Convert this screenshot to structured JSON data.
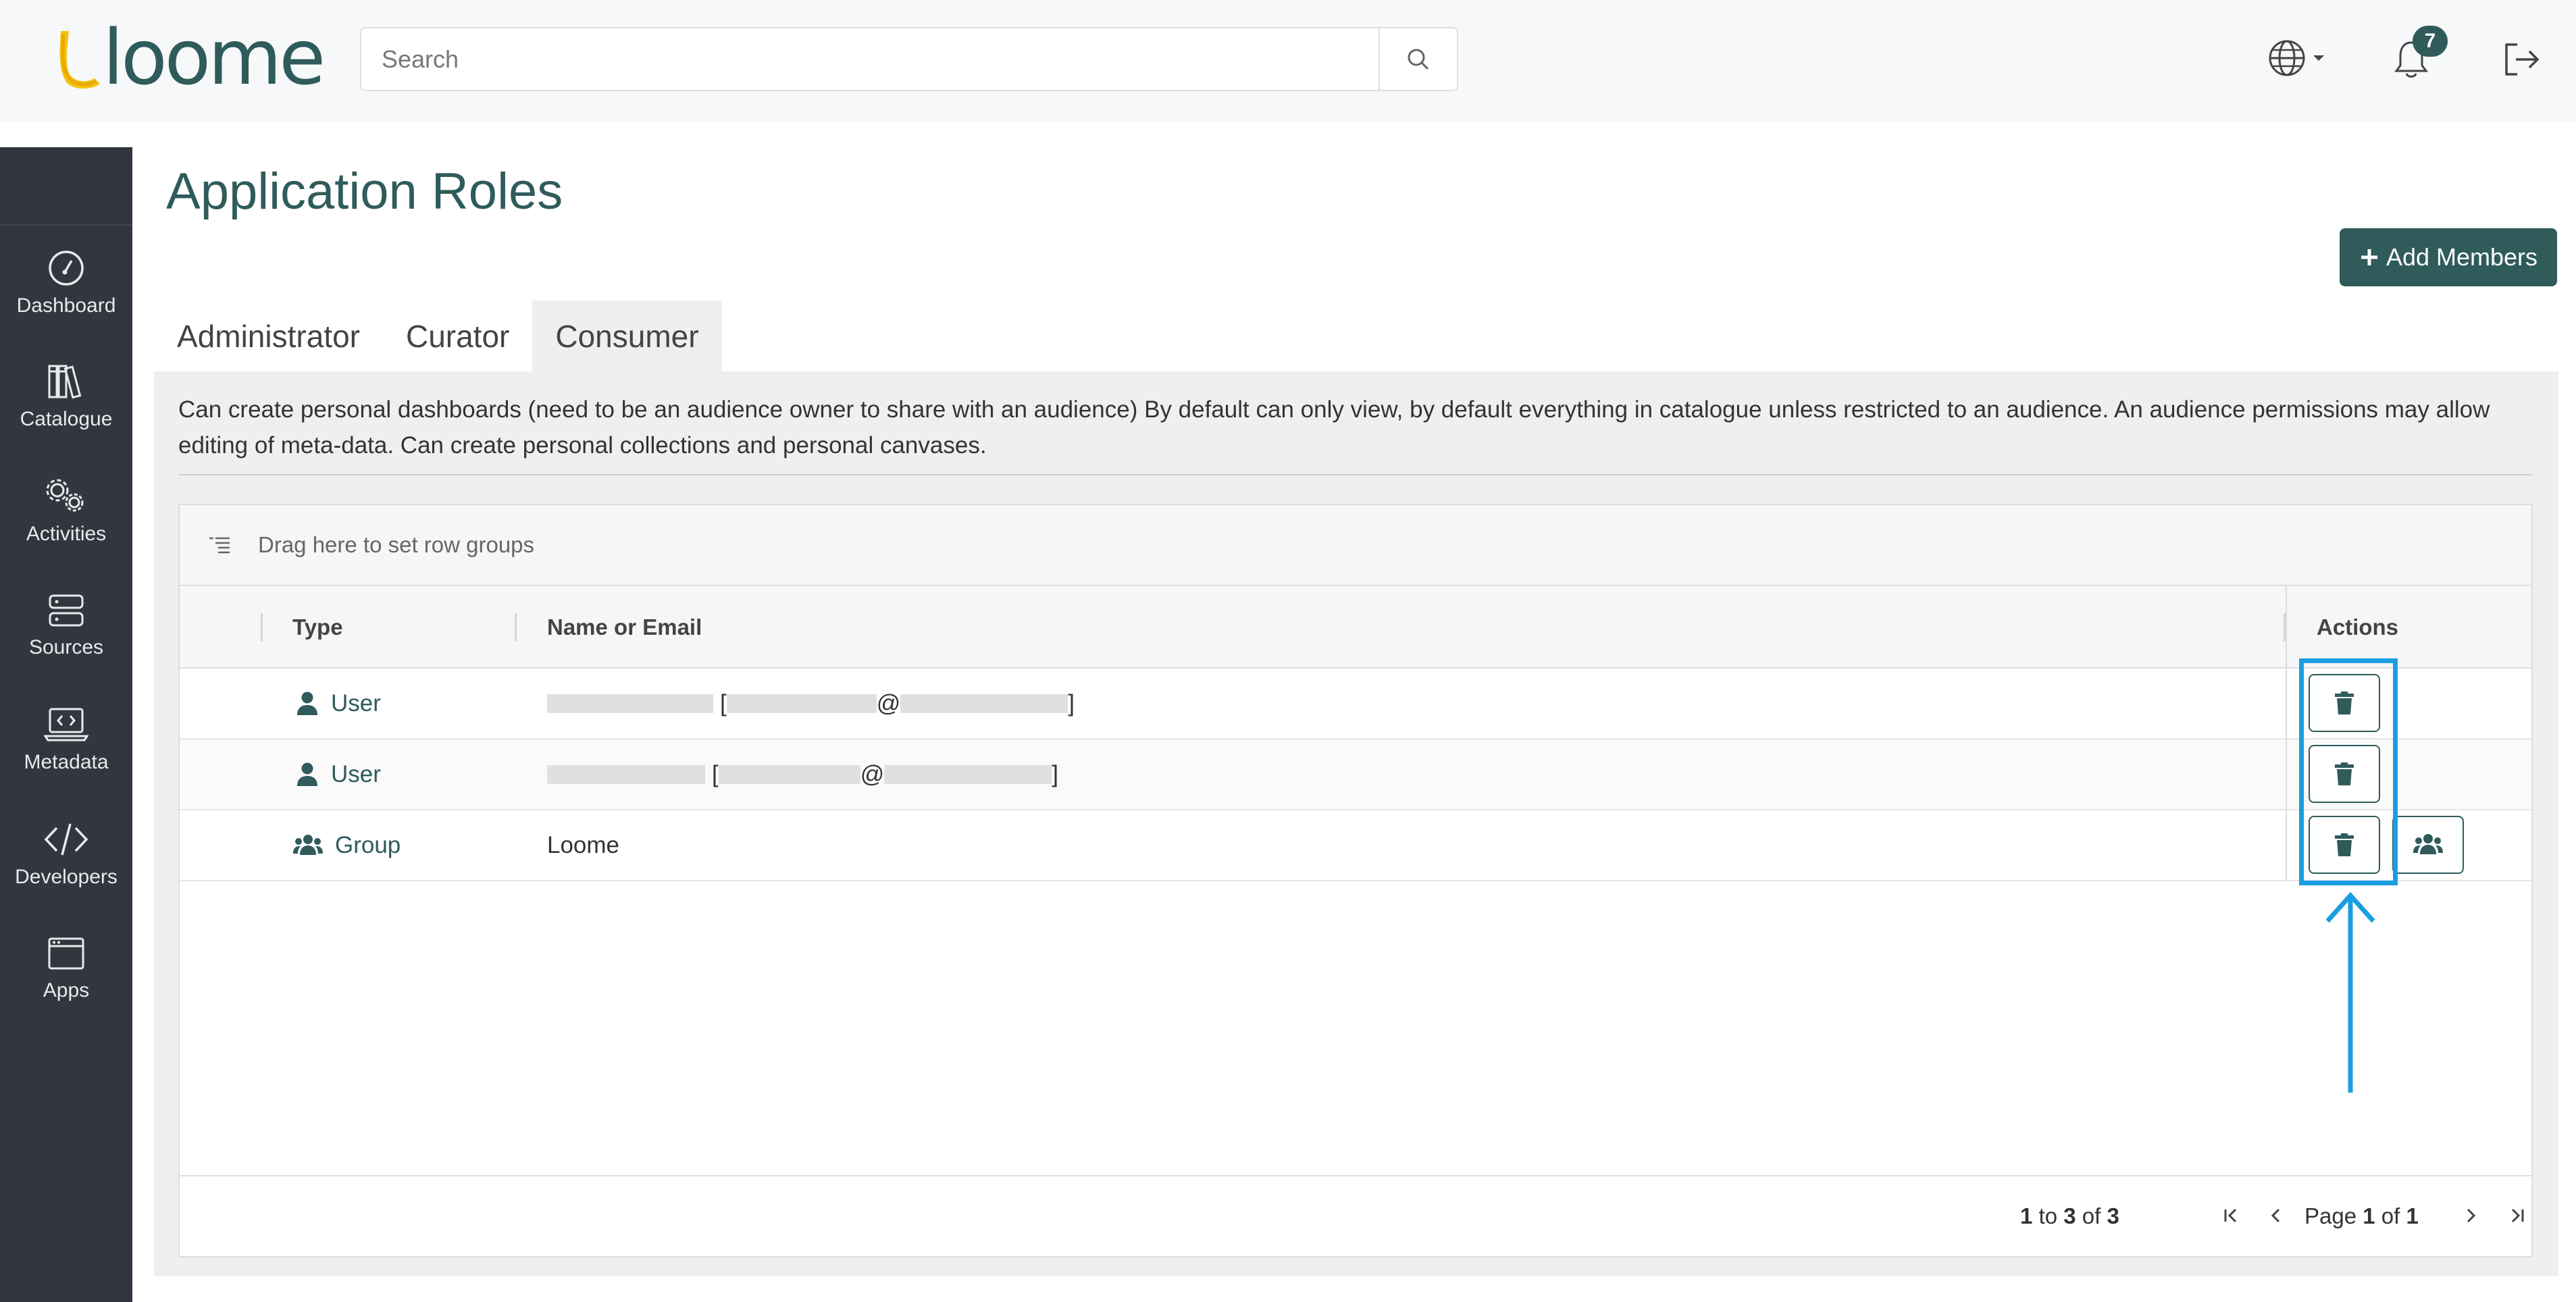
{
  "header": {
    "logo_text": "loome",
    "search_placeholder": "Search",
    "notification_count": "7",
    "icons": [
      "search-icon",
      "globe-icon",
      "chevron-down-icon",
      "bell-icon",
      "logout-icon"
    ]
  },
  "sidebar": {
    "items": [
      {
        "label": "Dashboard",
        "icon": "dashboard-icon"
      },
      {
        "label": "Catalogue",
        "icon": "catalogue-icon"
      },
      {
        "label": "Activities",
        "icon": "activities-icon"
      },
      {
        "label": "Sources",
        "icon": "sources-icon"
      },
      {
        "label": "Metadata",
        "icon": "metadata-icon"
      },
      {
        "label": "Developers",
        "icon": "developers-icon"
      },
      {
        "label": "Apps",
        "icon": "apps-icon"
      }
    ]
  },
  "page": {
    "title": "Application Roles",
    "add_members_label": "Add Members"
  },
  "tabs": [
    {
      "label": "Administrator",
      "active": false
    },
    {
      "label": "Curator",
      "active": false
    },
    {
      "label": "Consumer",
      "active": true
    }
  ],
  "role_description": "Can create personal dashboards (need to be an audience owner to share with an audience) By default can only view, by default everything in catalogue unless restricted to an audience. An audience permissions may allow editing of meta-data. Can create personal collections and personal canvases.",
  "grid": {
    "group_bar_text": "Drag here to set row groups",
    "columns": [
      "Type",
      "Name or Email",
      "Actions"
    ],
    "rows": [
      {
        "type": "User",
        "name": "",
        "at": "@",
        "bracket_open": "[",
        "bracket_close": "]"
      },
      {
        "type": "User",
        "name": "",
        "at": "@",
        "bracket_open": "[",
        "bracket_close": "]"
      },
      {
        "type": "Group",
        "name": "Loome"
      }
    ],
    "footer": {
      "from": "1",
      "to_word": "to",
      "to": "3",
      "of_word": "of",
      "total": "3",
      "page_word": "Page",
      "page": "1",
      "page_of_word": "of",
      "page_total": "1"
    }
  },
  "colors": {
    "brand": "#2f5b5b",
    "sidebar": "#32373f",
    "highlight": "#1a9ee0"
  }
}
